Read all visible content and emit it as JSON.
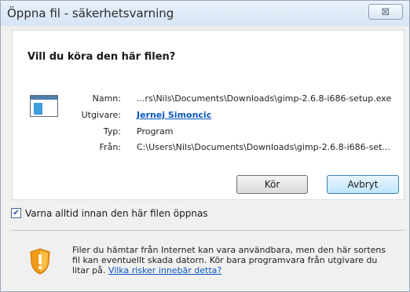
{
  "dialog": {
    "title": "Öppna fil - säkerhetsvarning",
    "close_symbol": "⊠"
  },
  "prompt": {
    "heading": "Vill du köra den här filen?"
  },
  "file": {
    "name_label": "Namn:",
    "name_value": "...rs\\Nils\\Documents\\Downloads\\gimp-2.6.8-i686-setup.exe",
    "publisher_label": "Utgivare:",
    "publisher_value": "Jernej Simoncic",
    "type_label": "Typ:",
    "type_value": "Program",
    "from_label": "Från:",
    "from_value": "C:\\Users\\Nils\\Documents\\Downloads\\gimp-2.6.8-i686-set..."
  },
  "buttons": {
    "run": "Kör",
    "cancel": "Avbryt"
  },
  "checkbox": {
    "label": "Varna alltid innan den här filen öppnas",
    "checked": true,
    "check_symbol": "✔"
  },
  "warning": {
    "line1": "Filer du hämtar från Internet kan vara användbara, men den här sortens",
    "line2": "fil kan eventuellt skada datorn. Kör bara programvara från utgivare du",
    "line3_prefix": "litar på. ",
    "link": "Vilka risker innebär detta?"
  },
  "icons": {
    "file": "program-file-icon",
    "warning": "security-shield-icon"
  },
  "colors": {
    "link": "#0b57bd",
    "primary_button": "#bee6fd",
    "shield_orange": "#f39a19"
  }
}
